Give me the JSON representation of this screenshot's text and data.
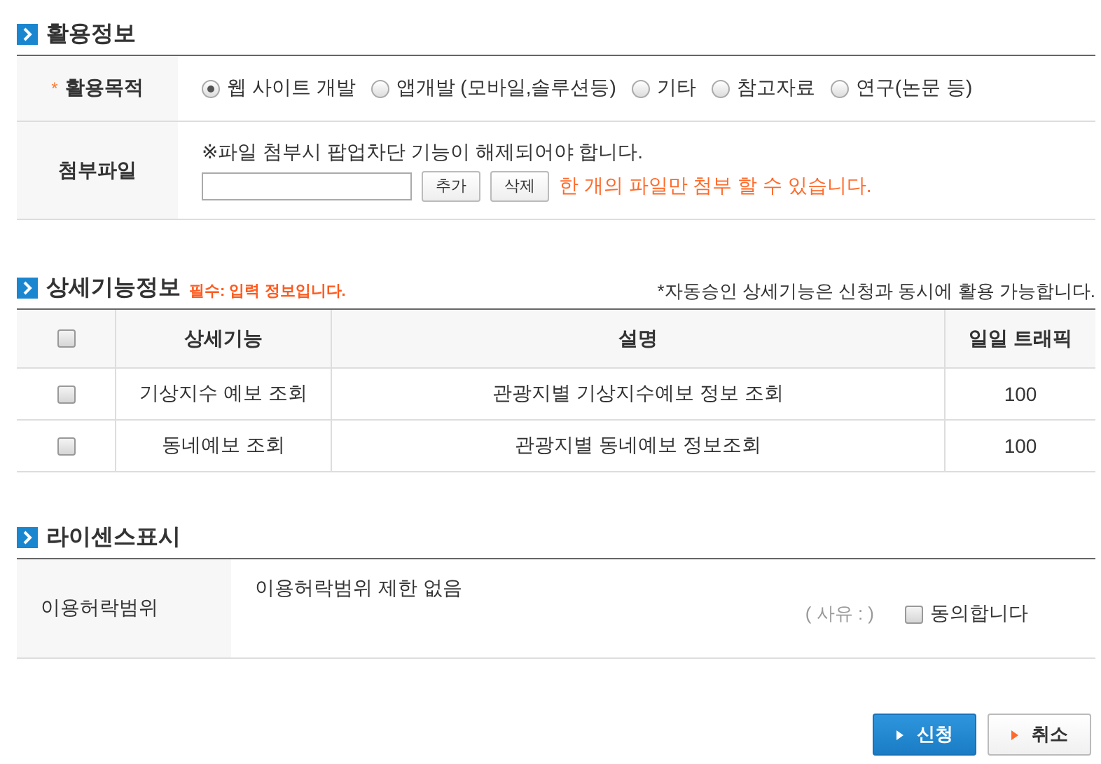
{
  "usage_info": {
    "title": "활용정보",
    "purpose": {
      "label": "활용목적",
      "required_mark": "*",
      "options": [
        {
          "label": "웹 사이트 개발",
          "selected": true
        },
        {
          "label": "앱개발 (모바일,솔루션등)",
          "selected": false
        },
        {
          "label": "기타",
          "selected": false
        },
        {
          "label": "참고자료",
          "selected": false
        },
        {
          "label": "연구(논문 등)",
          "selected": false
        }
      ]
    },
    "attachment": {
      "label": "첨부파일",
      "notice": "※파일 첨부시 팝업차단 기능이 해제되어야 합니다.",
      "add_button": "추가",
      "delete_button": "삭제",
      "hint": "한 개의 파일만 첨부 할 수 있습니다."
    }
  },
  "detail_info": {
    "title": "상세기능정보",
    "required_note": "필수: 입력 정보입니다.",
    "auto_note": "*자동승인 상세기능은 신청과 동시에 활용 가능합니다.",
    "select_all_checked": false,
    "columns": [
      "상세기능",
      "설명",
      "일일 트래픽"
    ],
    "rows": [
      {
        "checked": false,
        "cells": [
          "기상지수 예보 조회",
          "관광지별 기상지수예보 정보 조회",
          "100"
        ]
      },
      {
        "checked": false,
        "cells": [
          "동네예보 조회",
          "관광지별 동네예보 정보조회",
          "100"
        ]
      }
    ]
  },
  "license": {
    "title": "라이센스표시",
    "label": "이용허락범위",
    "value": "이용허락범위 제한 없음",
    "reason": "( 사유 : )",
    "agree": {
      "label": "동의합니다",
      "checked": false
    }
  },
  "buttons": [
    {
      "label": "신청",
      "kind": "primary"
    },
    {
      "label": "취소",
      "kind": "secondary"
    }
  ]
}
